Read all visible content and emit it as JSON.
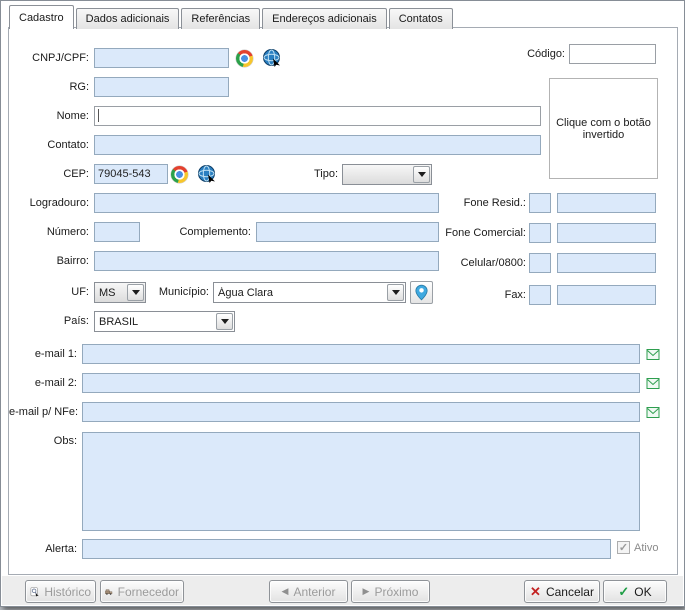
{
  "tabs": [
    {
      "label": "Cadastro",
      "active": true
    },
    {
      "label": "Dados adicionais",
      "active": false
    },
    {
      "label": "Referências",
      "active": false
    },
    {
      "label": "Endereços adicionais",
      "active": false
    },
    {
      "label": "Contatos",
      "active": false
    }
  ],
  "form": {
    "cnpj_cpf": {
      "label": "CNPJ/CPF:",
      "value": ""
    },
    "codigo": {
      "label": "Código:",
      "value": ""
    },
    "rg": {
      "label": "RG:",
      "value": ""
    },
    "nome": {
      "label": "Nome:",
      "value": ""
    },
    "contato": {
      "label": "Contato:",
      "value": ""
    },
    "cep": {
      "label": "CEP:",
      "value": "79045-543"
    },
    "tipo": {
      "label": "Tipo:",
      "value": ""
    },
    "logradouro": {
      "label": "Logradouro:",
      "value": ""
    },
    "numero": {
      "label": "Número:",
      "value": ""
    },
    "complemento": {
      "label": "Complemento:",
      "value": ""
    },
    "bairro": {
      "label": "Bairro:",
      "value": ""
    },
    "uf": {
      "label": "UF:",
      "value": "MS"
    },
    "municipio": {
      "label": "Município:",
      "value": "Água Clara"
    },
    "pais": {
      "label": "País:",
      "value": "BRASIL"
    },
    "email1": {
      "label": "e-mail 1:",
      "value": ""
    },
    "email2": {
      "label": "e-mail 2:",
      "value": ""
    },
    "email_nfe": {
      "label": "e-mail p/ NFe:",
      "value": ""
    },
    "obs": {
      "label": "Obs:",
      "value": ""
    },
    "alerta": {
      "label": "Alerta:",
      "value": ""
    },
    "fone_resid": {
      "label": "Fone Resid.:",
      "ddd": "",
      "number": ""
    },
    "fone_comercial": {
      "label": "Fone Comercial:",
      "ddd": "",
      "number": ""
    },
    "celular": {
      "label": "Celular/0800:",
      "ddd": "",
      "number": ""
    },
    "fax": {
      "label": "Fax:",
      "ddd": "",
      "number": ""
    }
  },
  "photo_box": {
    "text": "Clique com o botão invertido"
  },
  "checkbox_ativo": {
    "label": "Ativo",
    "checked": true
  },
  "buttons": {
    "historico": "Histórico",
    "fornecedor": "Fornecedor",
    "anterior": "Anterior",
    "proximo": "Próximo",
    "cancelar": "Cancelar",
    "ok": "OK"
  },
  "glyphs": {
    "prev": "◀",
    "next": "▶",
    "cancel": "✕",
    "ok": "✓",
    "check": "✓"
  },
  "colors": {
    "field_fill": "#dbe9fa",
    "field_border": "#94a9bd",
    "envelope_green": "#2e9e4f",
    "cancel_red": "#c32222",
    "ok_green": "#1f9e46",
    "pin_blue": "#3fa9e0"
  }
}
